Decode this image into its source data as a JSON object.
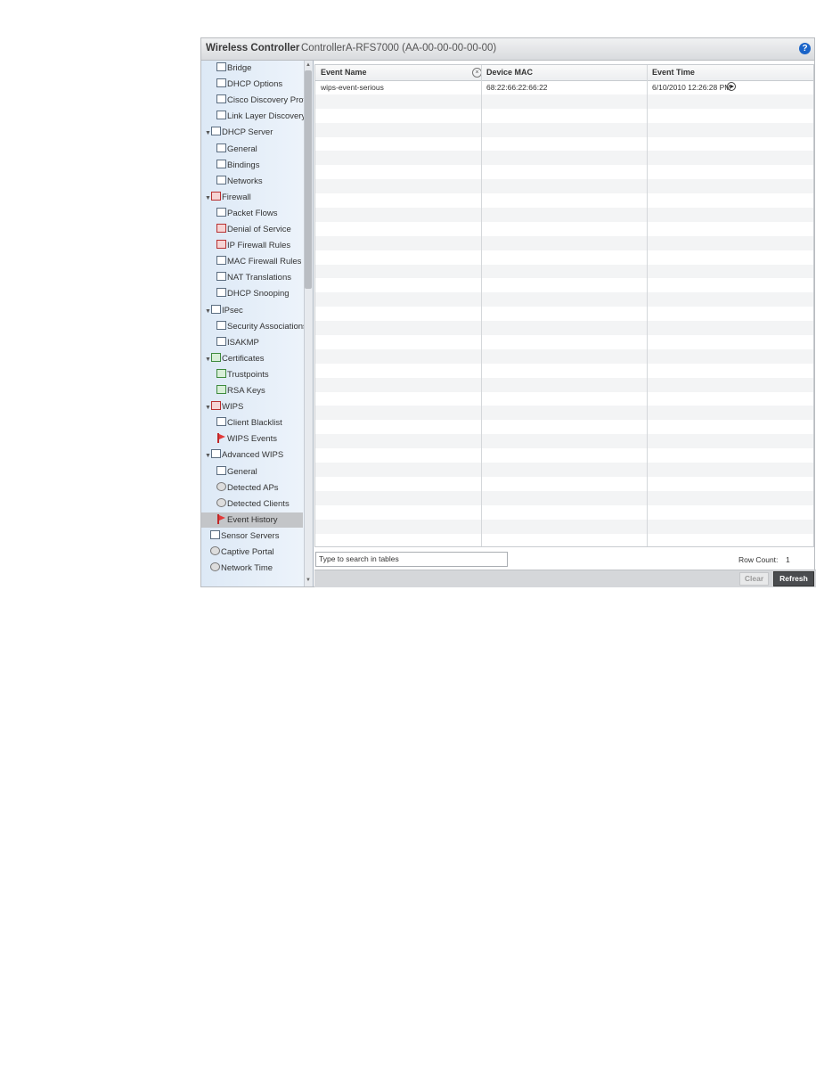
{
  "window": {
    "app_title": "Wireless Controller",
    "device_title": "ControllerA-RFS7000 (AA-00-00-00-00-00)",
    "help_glyph": "?"
  },
  "sidebar": {
    "items": [
      {
        "label": "Bridge",
        "icon": "network-icon"
      },
      {
        "label": "DHCP Options",
        "icon": "network-icon"
      },
      {
        "label": "Cisco Discovery Prot",
        "icon": "network-icon"
      },
      {
        "label": "Link Layer Discovery",
        "icon": "network-icon"
      },
      {
        "label": "DHCP Server",
        "icon": "network-icon",
        "expanded": true
      },
      {
        "label": "General",
        "icon": "network-icon"
      },
      {
        "label": "Bindings",
        "icon": "network-icon"
      },
      {
        "label": "Networks",
        "icon": "network-icon"
      },
      {
        "label": "Firewall",
        "icon": "firewall-icon",
        "expanded": true
      },
      {
        "label": "Packet Flows",
        "icon": "packet-flows-icon"
      },
      {
        "label": "Denial of Service",
        "icon": "denial-of-service-icon"
      },
      {
        "label": "IP Firewall Rules",
        "icon": "ip-firewall-icon"
      },
      {
        "label": "MAC Firewall Rules",
        "icon": "mac-firewall-icon"
      },
      {
        "label": "NAT Translations",
        "icon": "nat-icon"
      },
      {
        "label": "DHCP Snooping",
        "icon": "dhcp-snooping-icon"
      },
      {
        "label": "IPsec",
        "icon": "ipsec-icon",
        "expanded": true
      },
      {
        "label": "Security Associations",
        "icon": "security-association-icon"
      },
      {
        "label": "ISAKMP",
        "icon": "key-icon"
      },
      {
        "label": "Certificates",
        "icon": "certificate-icon",
        "expanded": true
      },
      {
        "label": "Trustpoints",
        "icon": "certificate-icon"
      },
      {
        "label": "RSA Keys",
        "icon": "certificate-icon"
      },
      {
        "label": "WIPS",
        "icon": "warning-icon",
        "expanded": true
      },
      {
        "label": "Client Blacklist",
        "icon": "blacklist-icon"
      },
      {
        "label": "WIPS Events",
        "icon": "flag-icon"
      },
      {
        "label": "Advanced WIPS",
        "icon": "advanced-wips-icon",
        "expanded": true
      },
      {
        "label": "General",
        "icon": "sensor-icon"
      },
      {
        "label": "Detected APs",
        "icon": "access-point-icon"
      },
      {
        "label": "Detected Clients",
        "icon": "client-icon"
      },
      {
        "label": "Event History",
        "icon": "flag-icon",
        "selected": true
      },
      {
        "label": "Sensor Servers",
        "icon": "sensor-icon"
      },
      {
        "label": "Captive Portal",
        "icon": "portal-icon"
      },
      {
        "label": "Network Time",
        "icon": "clock-icon"
      }
    ]
  },
  "table": {
    "columns": [
      "Event Name",
      "Device MAC",
      "Event Time"
    ],
    "rows": [
      {
        "event_name": "wips-event-serious",
        "device_mac": "68:22:66:22:66:22",
        "event_time": "6/10/2010 12:26:28 PM"
      }
    ]
  },
  "search": {
    "placeholder": "Type to search in tables"
  },
  "row_count": {
    "label": "Row Count:",
    "value": "1"
  },
  "buttons": {
    "clear": "Clear",
    "refresh": "Refresh"
  }
}
